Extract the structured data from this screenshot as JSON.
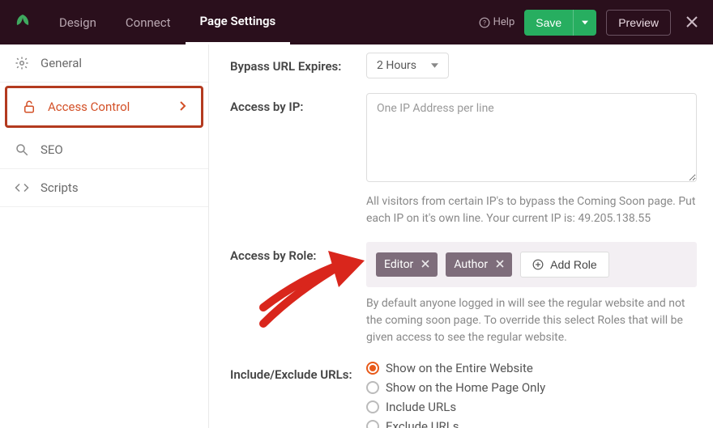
{
  "topbar": {
    "tabs": [
      "Design",
      "Connect",
      "Page Settings"
    ],
    "active_tab": 2,
    "help_label": "Help",
    "save_label": "Save",
    "preview_label": "Preview"
  },
  "sidebar": {
    "items": [
      {
        "label": "General"
      },
      {
        "label": "Access Control"
      },
      {
        "label": "SEO"
      },
      {
        "label": "Scripts"
      }
    ],
    "active_index": 1
  },
  "form": {
    "bypass_label": "Bypass URL Expires:",
    "bypass_value": "2 Hours",
    "access_ip_label": "Access by IP:",
    "access_ip_placeholder": "One IP Address per line",
    "access_ip_help": "All visitors from certain IP's to bypass the Coming Soon page. Put each IP on it's own line. Your current IP is: 49.205.138.55",
    "access_role_label": "Access by Role:",
    "roles": [
      "Editor",
      "Author"
    ],
    "add_role_label": "Add Role",
    "access_role_help": "By default anyone logged in will see the regular website and not the coming soon page. To override this select Roles that will be given access to see the regular website.",
    "include_label": "Include/Exclude URLs:",
    "include_options": [
      "Show on the Entire Website",
      "Show on the Home Page Only",
      "Include URLs",
      "Exclude URLs"
    ],
    "include_selected": 0
  }
}
